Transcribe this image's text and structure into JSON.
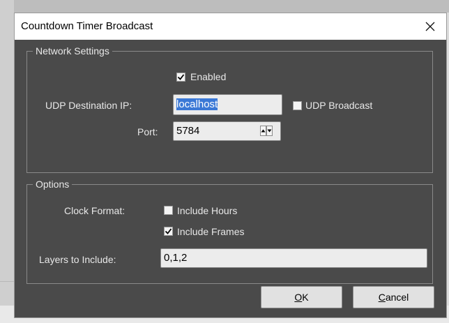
{
  "window": {
    "title": "Countdown Timer Broadcast"
  },
  "network": {
    "legend": "Network Settings",
    "enabled_label": "Enabled",
    "enabled_checked": true,
    "udp_ip_label": "UDP Destination IP:",
    "udp_ip_value": "localhost",
    "udp_broadcast_label": "UDP Broadcast",
    "udp_broadcast_checked": false,
    "port_label": "Port:",
    "port_value": "5784"
  },
  "options": {
    "legend": "Options",
    "clock_format_label": "Clock Format:",
    "include_hours_label": "Include Hours",
    "include_hours_checked": false,
    "include_frames_label": "Include Frames",
    "include_frames_checked": true,
    "layers_label": "Layers to Include:",
    "layers_value": "0,1,2"
  },
  "buttons": {
    "ok_mnemonic": "O",
    "ok_rest": "K",
    "cancel_mnemonic": "C",
    "cancel_rest": "ancel"
  },
  "icons": {
    "close": "close-icon",
    "check": "checkmark-icon",
    "spin_up": "spin-up-icon",
    "spin_down": "spin-down-icon"
  }
}
